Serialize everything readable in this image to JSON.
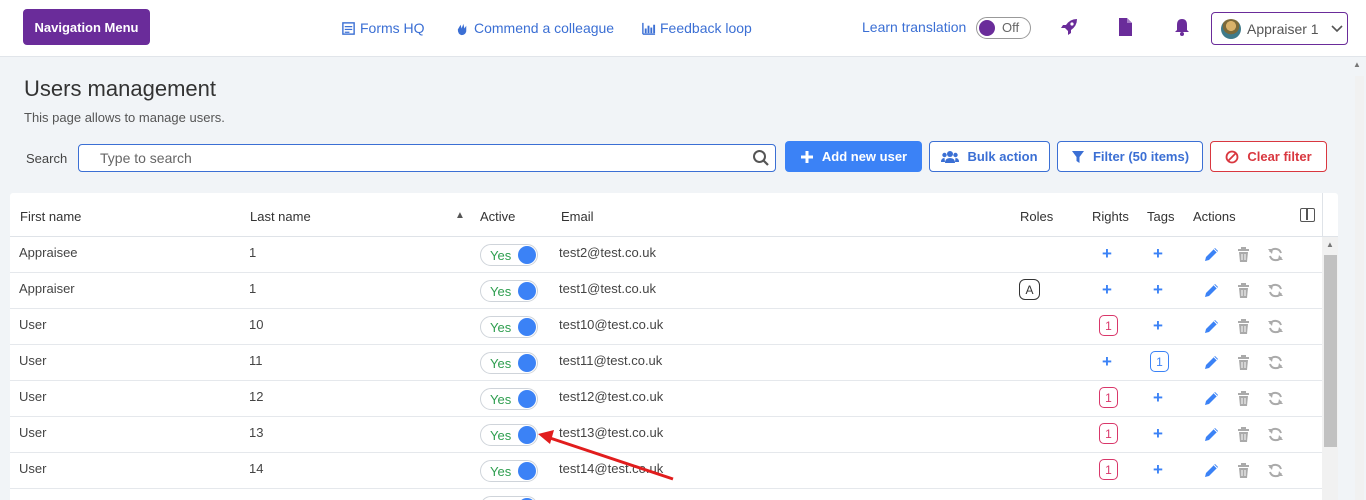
{
  "header": {
    "nav_button": "Navigation Menu",
    "links": [
      {
        "label": "Forms HQ",
        "icon": "form-icon"
      },
      {
        "label": "Commend a colleague",
        "icon": "hand-icon"
      },
      {
        "label": "Feedback loop",
        "icon": "chart-icon"
      }
    ],
    "learn_translation": "Learn translation",
    "translation_toggle": "Off",
    "user_name": "Appraiser 1",
    "colors": {
      "brand": "#6a2c9a",
      "link": "#3b6fd4"
    }
  },
  "page": {
    "title": "Users management",
    "subtitle": "This page allows to manage users.",
    "search_label": "Search",
    "search_placeholder": "Type to search"
  },
  "actions": {
    "add": "Add new user",
    "bulk": "Bulk action",
    "filter": "Filter (50 items)",
    "clear": "Clear filter"
  },
  "table": {
    "headers": {
      "first_name": "First name",
      "last_name": "Last name",
      "active": "Active",
      "email": "Email",
      "roles": "Roles",
      "rights": "Rights",
      "tags": "Tags",
      "actions": "Actions"
    },
    "rows": [
      {
        "first": "Appraisee",
        "last": "1",
        "active": "Yes",
        "email": "test2@test.co.uk",
        "role": "",
        "rights": "",
        "tags": ""
      },
      {
        "first": "Appraiser",
        "last": "1",
        "active": "Yes",
        "email": "test1@test.co.uk",
        "role": "A",
        "rights": "",
        "tags": ""
      },
      {
        "first": "User",
        "last": "10",
        "active": "Yes",
        "email": "test10@test.co.uk",
        "role": "",
        "rights": "1",
        "tags": ""
      },
      {
        "first": "User",
        "last": "11",
        "active": "Yes",
        "email": "test11@test.co.uk",
        "role": "",
        "rights": "",
        "tags": "1"
      },
      {
        "first": "User",
        "last": "12",
        "active": "Yes",
        "email": "test12@test.co.uk",
        "role": "",
        "rights": "1",
        "tags": ""
      },
      {
        "first": "User",
        "last": "13",
        "active": "Yes",
        "email": "test13@test.co.uk",
        "role": "",
        "rights": "1",
        "tags": ""
      },
      {
        "first": "User",
        "last": "14",
        "active": "Yes",
        "email": "test14@test.co.uk",
        "role": "",
        "rights": "1",
        "tags": ""
      }
    ]
  }
}
